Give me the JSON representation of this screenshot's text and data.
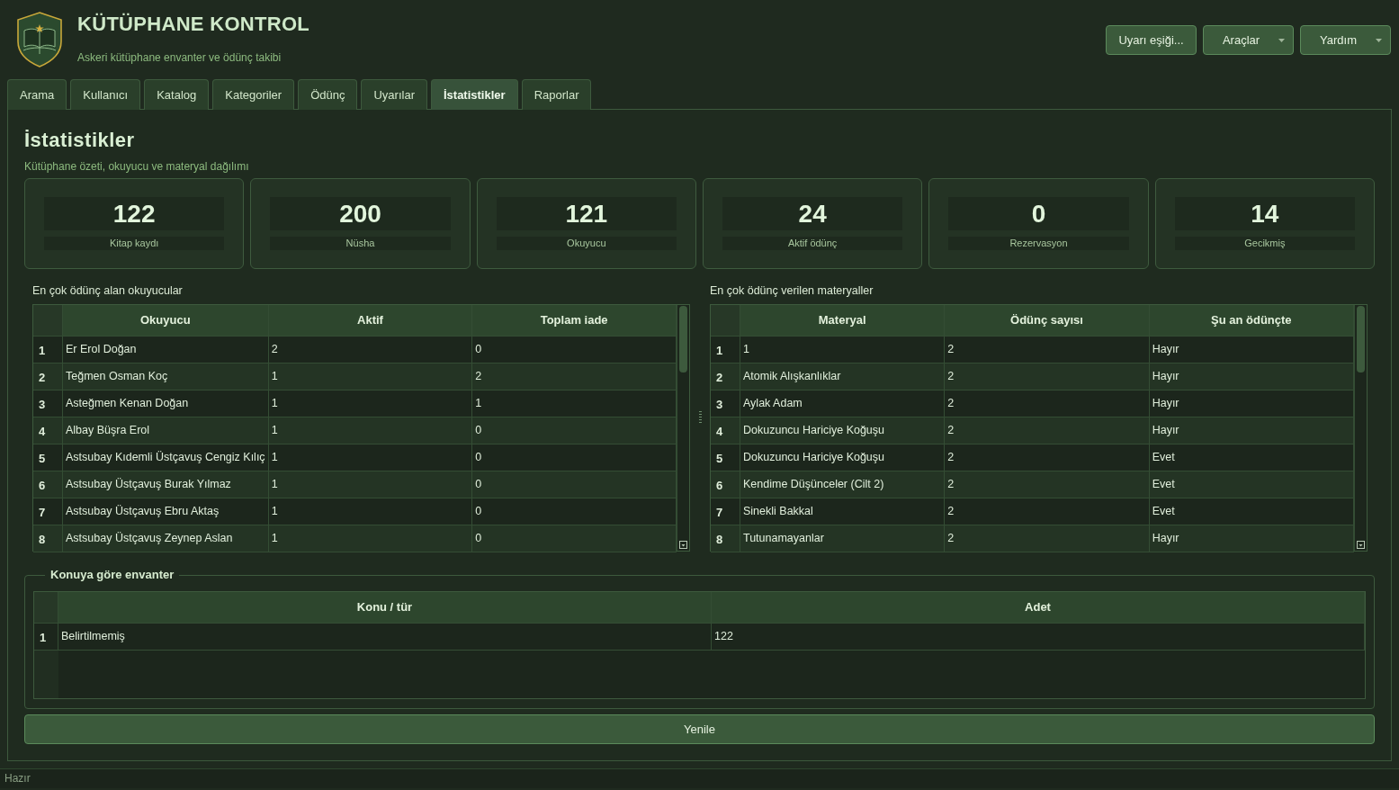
{
  "header": {
    "title": "KÜTÜPHANE KONTROL",
    "subtitle": "Askeri kütüphane envanter ve ödünç takibi"
  },
  "toolbar": [
    {
      "label": "Uyarı eşiği...",
      "kind": "action"
    },
    {
      "label": "Araçlar",
      "kind": "menu"
    },
    {
      "label": "Yardım",
      "kind": "menu"
    }
  ],
  "tabs": [
    {
      "label": "Arama",
      "selected": false
    },
    {
      "label": "Kullanıcı",
      "selected": false
    },
    {
      "label": "Katalog",
      "selected": false
    },
    {
      "label": "Kategoriler",
      "selected": false
    },
    {
      "label": "Ödünç",
      "selected": false
    },
    {
      "label": "Uyarılar",
      "selected": false
    },
    {
      "label": "İstatistikler",
      "selected": true
    },
    {
      "label": "Raporlar",
      "selected": false
    }
  ],
  "page": {
    "title": "İstatistikler",
    "subtitle": "Kütüphane özeti, okuyucu ve materyal dağılımı"
  },
  "stats": [
    {
      "value": "122",
      "label": "Kitap kaydı"
    },
    {
      "value": "200",
      "label": "Nüsha"
    },
    {
      "value": "121",
      "label": "Okuyucu"
    },
    {
      "value": "24",
      "label": "Aktif ödünç"
    },
    {
      "value": "0",
      "label": "Rezervasyon"
    },
    {
      "value": "14",
      "label": "Gecikmiş"
    }
  ],
  "tables": [
    {
      "caption": "En çok ödünç alan okuyucular",
      "columns": [
        "Okuyucu",
        "Aktif",
        "Toplam iade"
      ],
      "rows": [
        {
          "number": "1",
          "cells": [
            "Er Erol Doğan",
            "2",
            "0"
          ]
        },
        {
          "number": "2",
          "cells": [
            "Teğmen Osman Koç",
            "1",
            "2"
          ]
        },
        {
          "number": "3",
          "cells": [
            "Asteğmen Kenan Doğan",
            "1",
            "1"
          ]
        },
        {
          "number": "4",
          "cells": [
            "Albay Büşra Erol",
            "1",
            "0"
          ]
        },
        {
          "number": "5",
          "cells": [
            "Astsubay Kıdemli Üstçavuş Cengiz Kılıç",
            "1",
            "0"
          ]
        },
        {
          "number": "6",
          "cells": [
            "Astsubay Üstçavuş Burak Yılmaz",
            "1",
            "0"
          ]
        },
        {
          "number": "7",
          "cells": [
            "Astsubay Üstçavuş Ebru Aktaş",
            "1",
            "0"
          ]
        },
        {
          "number": "8",
          "cells": [
            "Astsubay Üstçavuş Zeynep Aslan",
            "1",
            "0"
          ]
        }
      ]
    },
    {
      "caption": "En çok ödünç verilen materyaller",
      "columns": [
        "Materyal",
        "Ödünç sayısı",
        "Şu an ödünçte"
      ],
      "rows": [
        {
          "number": "1",
          "cells": [
            "1",
            "2",
            "Hayır"
          ]
        },
        {
          "number": "2",
          "cells": [
            "Atomik Alışkanlıklar",
            "2",
            "Hayır"
          ]
        },
        {
          "number": "3",
          "cells": [
            "Aylak Adam",
            "2",
            "Hayır"
          ]
        },
        {
          "number": "4",
          "cells": [
            "Dokuzuncu Hariciye Koğuşu",
            "2",
            "Hayır"
          ]
        },
        {
          "number": "5",
          "cells": [
            "Dokuzuncu Hariciye Koğuşu",
            "2",
            "Evet"
          ]
        },
        {
          "number": "6",
          "cells": [
            "Kendime Düşünceler (Cilt 2)",
            "2",
            "Evet"
          ]
        },
        {
          "number": "7",
          "cells": [
            "Sinekli Bakkal",
            "2",
            "Evet"
          ]
        },
        {
          "number": "8",
          "cells": [
            "Tutunamayanlar",
            "2",
            "Hayır"
          ]
        }
      ]
    }
  ],
  "inventory": {
    "title": "Konuya göre envanter",
    "columns": [
      "Konu / tür",
      "Adet"
    ],
    "rows": [
      {
        "number": "1",
        "cells": [
          "Belirtilmemiş",
          "122"
        ]
      }
    ]
  },
  "refresh_button": "Yenile",
  "status_bar": "Hazır"
}
